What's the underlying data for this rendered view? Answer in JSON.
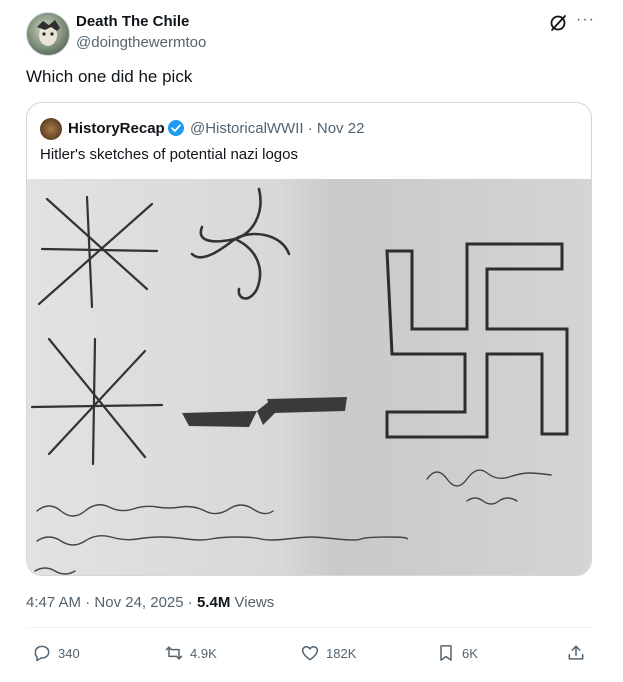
{
  "author": {
    "name": "Death The Chile",
    "handle": "@doingthewermtoo"
  },
  "post": {
    "text": "Which one did he pick",
    "time": "4:47 AM",
    "date": "Nov 24, 2025",
    "views_count": "5.4M",
    "views_label": "Views"
  },
  "quote": {
    "name": "HistoryRecap",
    "handle_and_date": "@HistoricalWWII · Nov 22",
    "text": "Hitler's sketches of potential nazi logos"
  },
  "actions": {
    "replies": "340",
    "reposts": "4.9K",
    "likes": "182K",
    "bookmarks": "6K"
  },
  "colors": {
    "verified": "#1d9bf0",
    "secondary_text": "#536471"
  },
  "icons": [
    "grok-icon",
    "more-icon",
    "verified-icon",
    "reply-icon",
    "repost-icon",
    "like-icon",
    "bookmark-icon",
    "share-icon"
  ]
}
